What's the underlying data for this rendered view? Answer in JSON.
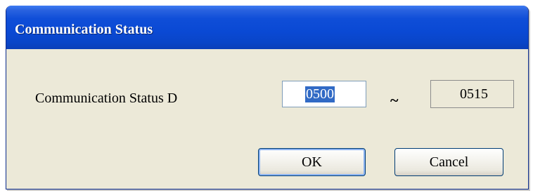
{
  "dialog": {
    "title": "Communication Status",
    "field_label": "Communication Status D",
    "start_value": "0500",
    "separator": "~",
    "end_value": "0515",
    "ok_label": "OK",
    "cancel_label": "Cancel"
  },
  "colors": {
    "title_bar": "#0a49d4",
    "client_background": "#ece9d8",
    "selection": "#316ac5"
  }
}
